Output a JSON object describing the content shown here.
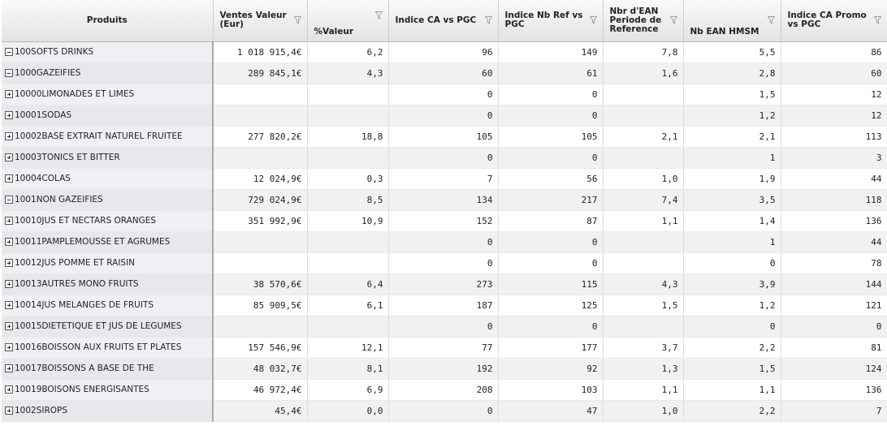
{
  "columns": [
    {
      "label": "Produits"
    },
    {
      "label": "Ventes Valeur (Eur)"
    },
    {
      "label": "%Valeur"
    },
    {
      "label": "Indice CA vs PGC"
    },
    {
      "label": "Indice Nb Ref vs PGC"
    },
    {
      "label": "Nbr d'EAN Periode de Reference"
    },
    {
      "label": "Nb EAN HMSM"
    },
    {
      "label": "Indice CA Promo vs PGC"
    }
  ],
  "rows": [
    {
      "level": 1,
      "toggle": "collapse",
      "name": "100SOFTS DRINKS",
      "values": [
        "1 018 915,4€",
        "6,2",
        "96",
        "149",
        "7,8",
        "5,5",
        "86"
      ]
    },
    {
      "level": 2,
      "toggle": "collapse",
      "name": "1000GAZEIFIES",
      "values": [
        "289 845,1€",
        "4,3",
        "60",
        "61",
        "1,6",
        "2,8",
        "60"
      ]
    },
    {
      "level": 3,
      "toggle": "expand",
      "name": "10000LIMONADES ET LIMES",
      "values": [
        "",
        "",
        "0",
        "0",
        "",
        "1,5",
        "12"
      ]
    },
    {
      "level": 3,
      "toggle": "expand",
      "name": "10001SODAS",
      "values": [
        "",
        "",
        "0",
        "0",
        "",
        "1,2",
        "12"
      ]
    },
    {
      "level": 3,
      "toggle": "expand",
      "name": "10002BASE EXTRAIT NATUREL FRUITEE",
      "values": [
        "277 820,2€",
        "18,8",
        "105",
        "105",
        "2,1",
        "2,1",
        "113"
      ]
    },
    {
      "level": 3,
      "toggle": "expand",
      "name": "10003TONICS ET BITTER",
      "values": [
        "",
        "",
        "0",
        "0",
        "",
        "1",
        "3"
      ]
    },
    {
      "level": 3,
      "toggle": "expand",
      "name": "10004COLAS",
      "values": [
        "12 024,9€",
        "0,3",
        "7",
        "56",
        "1,0",
        "1,9",
        "44"
      ]
    },
    {
      "level": 2,
      "toggle": "collapse",
      "name": "1001NON GAZEIFIES",
      "values": [
        "729 024,9€",
        "8,5",
        "134",
        "217",
        "7,4",
        "3,5",
        "118"
      ]
    },
    {
      "level": 3,
      "toggle": "expand",
      "name": "10010JUS ET NECTARS ORANGES",
      "values": [
        "351 992,9€",
        "10,9",
        "152",
        "87",
        "1,1",
        "1,4",
        "136"
      ]
    },
    {
      "level": 3,
      "toggle": "expand",
      "name": "10011PAMPLEMOUSSE ET AGRUMES",
      "values": [
        "",
        "",
        "0",
        "0",
        "",
        "1",
        "44"
      ]
    },
    {
      "level": 3,
      "toggle": "expand",
      "name": "10012JUS POMME ET RAISIN",
      "values": [
        "",
        "",
        "0",
        "0",
        "",
        "0",
        "78"
      ]
    },
    {
      "level": 3,
      "toggle": "expand",
      "name": "10013AUTRES MONO FRUITS",
      "values": [
        "38 570,6€",
        "6,4",
        "273",
        "115",
        "4,3",
        "3,9",
        "144"
      ]
    },
    {
      "level": 3,
      "toggle": "expand",
      "name": "10014JUS MELANGES DE FRUITS",
      "values": [
        "85 909,5€",
        "6,1",
        "187",
        "125",
        "1,5",
        "1,2",
        "121"
      ]
    },
    {
      "level": 3,
      "toggle": "expand",
      "name": "10015DIETETIQUE ET JUS DE LEGUMES",
      "values": [
        "",
        "",
        "0",
        "0",
        "",
        "0",
        "0"
      ]
    },
    {
      "level": 3,
      "toggle": "expand",
      "name": "10016BOISSON AUX FRUITS ET PLATES",
      "values": [
        "157 546,9€",
        "12,1",
        "77",
        "177",
        "3,7",
        "2,2",
        "81"
      ]
    },
    {
      "level": 3,
      "toggle": "expand",
      "name": "10017BOISSONS A BASE DE THE",
      "values": [
        "48 032,7€",
        "8,1",
        "192",
        "92",
        "1,3",
        "1,5",
        "124"
      ]
    },
    {
      "level": 3,
      "toggle": "expand",
      "name": "10019BOISONS ENERGISANTES",
      "values": [
        "46 972,4€",
        "6,9",
        "208",
        "103",
        "1,1",
        "1,1",
        "136"
      ]
    },
    {
      "level": 2,
      "toggle": "expand",
      "name": "1002SIROPS",
      "values": [
        "45,4€",
        "0,0",
        "0",
        "47",
        "1,0",
        "2,2",
        "7"
      ]
    }
  ]
}
